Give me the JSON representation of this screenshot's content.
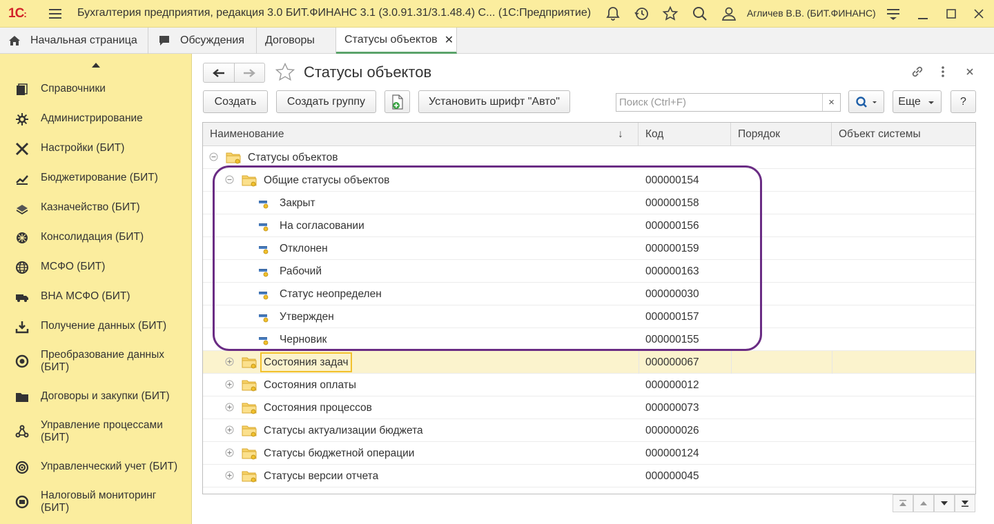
{
  "titlebar": {
    "logo_text": "1С",
    "app_title": "Бухгалтерия предприятия, редакция 3.0  БИТ.ФИНАНС 3.1 (3.0.91.31/3.1.48.4) С...   (1С:Предприятие)",
    "user": "Агличев В.В. (БИТ.ФИНАНС)",
    "icons": [
      "menu-icon",
      "bell-icon",
      "history-icon",
      "star-icon",
      "search-icon",
      "user-icon",
      "settings-menu-icon",
      "minimize-icon",
      "maximize-icon",
      "close-icon"
    ]
  },
  "tabs": [
    {
      "label": "Начальная страница",
      "icon": "home-icon"
    },
    {
      "label": "Обсуждения",
      "icon": "chat-icon"
    },
    {
      "label": "Договоры"
    },
    {
      "label": "Статусы объектов",
      "close": "✕",
      "active": true
    }
  ],
  "sidebar": {
    "items": [
      {
        "label": "Справочники",
        "icon": "books-icon"
      },
      {
        "label": "Администрирование",
        "icon": "gear-icon"
      },
      {
        "label": "Настройки (БИТ)",
        "icon": "tools-icon"
      },
      {
        "label": "Бюджетирование (БИТ)",
        "icon": "chart-up-icon"
      },
      {
        "label": "Казначейство (БИТ)",
        "icon": "money-icon"
      },
      {
        "label": "Консолидация (БИТ)",
        "icon": "network-icon"
      },
      {
        "label": "МСФО (БИТ)",
        "icon": "globe-icon"
      },
      {
        "label": "ВНА МСФО (БИТ)",
        "icon": "truck-icon"
      },
      {
        "label": "Получение данных (БИТ)",
        "icon": "download-icon"
      },
      {
        "label": "Преобразование данных (БИТ)",
        "icon": "transform-icon"
      },
      {
        "label": "Договоры и закупки (БИТ)",
        "icon": "folder-icon"
      },
      {
        "label": "Управление процессами (БИТ)",
        "icon": "process-icon"
      },
      {
        "label": "Управленческий учет (БИТ)",
        "icon": "target-icon"
      },
      {
        "label": "Налоговый мониторинг (БИТ)",
        "icon": "monitor-icon"
      }
    ]
  },
  "form": {
    "title": "Статусы объектов",
    "buttons": {
      "create": "Создать",
      "create_group": "Создать группу",
      "set_font": "Установить шрифт \"Авто\"",
      "more": "Еще",
      "help": "?"
    },
    "search_placeholder": "Поиск (Ctrl+F)",
    "search_clear": "×"
  },
  "table": {
    "columns": [
      "Наименование",
      "Код",
      "Порядок",
      "Объект системы"
    ],
    "sort_indicator": "↓",
    "rows": [
      {
        "name": "Статусы объектов",
        "code": "",
        "level": 0,
        "type": "folder",
        "expanded": true
      },
      {
        "name": "Общие статусы объектов",
        "code": "000000154",
        "level": 1,
        "type": "folder",
        "expanded": true
      },
      {
        "name": "Закрыт",
        "code": "000000158",
        "level": 2,
        "type": "item"
      },
      {
        "name": "На согласовании",
        "code": "000000156",
        "level": 2,
        "type": "item"
      },
      {
        "name": "Отклонен",
        "code": "000000159",
        "level": 2,
        "type": "item"
      },
      {
        "name": "Рабочий",
        "code": "000000163",
        "level": 2,
        "type": "item"
      },
      {
        "name": "Статус неопределен",
        "code": "000000030",
        "level": 2,
        "type": "item"
      },
      {
        "name": "Утвержден",
        "code": "000000157",
        "level": 2,
        "type": "item"
      },
      {
        "name": "Черновик",
        "code": "000000155",
        "level": 2,
        "type": "item"
      },
      {
        "name": "Состояния задач",
        "code": "000000067",
        "level": 1,
        "type": "folder",
        "expanded": false,
        "selected": true
      },
      {
        "name": "Состояния оплаты",
        "code": "000000012",
        "level": 1,
        "type": "folder",
        "expanded": false
      },
      {
        "name": "Состояния процессов",
        "code": "000000073",
        "level": 1,
        "type": "folder",
        "expanded": false
      },
      {
        "name": "Статусы актуализации бюджета",
        "code": "000000026",
        "level": 1,
        "type": "folder",
        "expanded": false
      },
      {
        "name": "Статусы бюджетной операции",
        "code": "000000124",
        "level": 1,
        "type": "folder",
        "expanded": false
      },
      {
        "name": "Статусы версии отчета",
        "code": "000000045",
        "level": 1,
        "type": "folder",
        "expanded": false
      }
    ]
  },
  "colors": {
    "sidebar_bg": "#fbed9e",
    "selected_row": "#fbf3cd",
    "highlight_frame": "#6a2c84",
    "logo_red": "#d2232a"
  }
}
